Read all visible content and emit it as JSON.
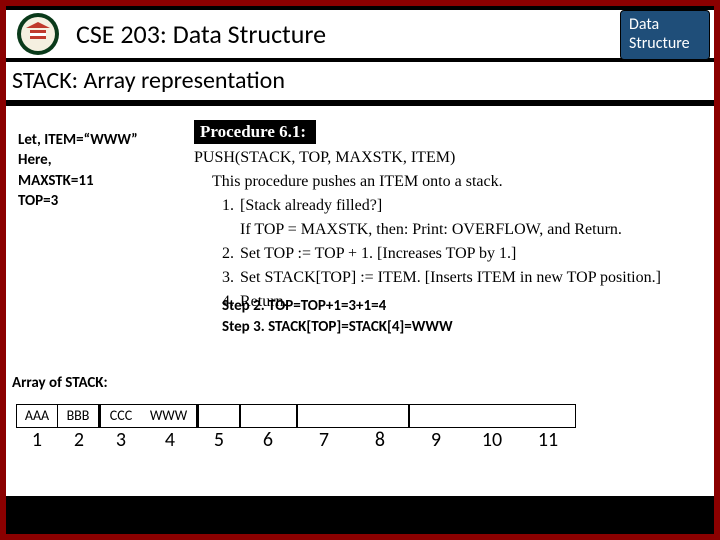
{
  "header": {
    "course_title": "CSE 203: Data Structure",
    "badge_line1": "Data",
    "badge_line2": "Structure"
  },
  "subtitle": "STACK: Array representation",
  "notes": {
    "l1": "Let, ITEM=“WWW”",
    "l2": "Here,",
    "l3": "MAXSTK=11",
    "l4": "TOP=3"
  },
  "procedure": {
    "title": "Procedure 6.1:",
    "signature": "PUSH(STACK, TOP, MAXSTK, ITEM)",
    "description": "This procedure pushes an ITEM onto a stack.",
    "s1": "[Stack already filled?]",
    "s1b": "If TOP = MAXSTK, then: Print: OVERFLOW, and Return.",
    "s2": "Set TOP := TOP + 1. [Increases TOP by 1.]",
    "s3": "Set STACK[TOP] := ITEM. [Inserts ITEM in new TOP position.]",
    "s4": "Return."
  },
  "steps": {
    "l1": "Step 2. TOP=TOP+1=3+1=4",
    "l2": "Step 3. STACK[TOP]=STACK[4]=WWW"
  },
  "array": {
    "label": "Array of STACK:",
    "cells": [
      "AAA",
      "BBB",
      "CCC",
      "WWW",
      "",
      "",
      "",
      "",
      "",
      "",
      ""
    ],
    "indices": [
      "1",
      "2",
      "3",
      "4",
      "5",
      "6",
      "7",
      "8",
      "9",
      "10",
      "11"
    ]
  }
}
